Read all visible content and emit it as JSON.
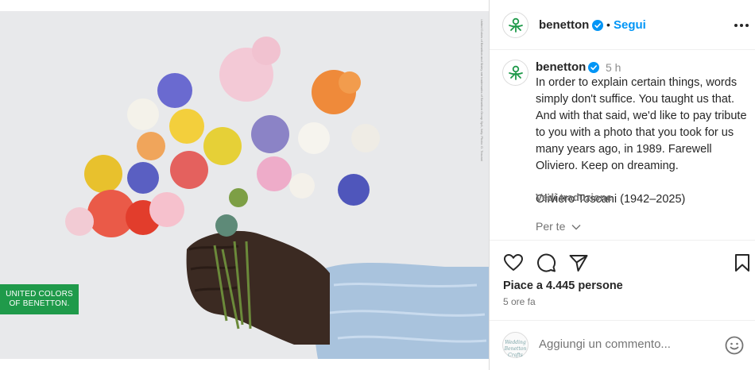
{
  "media": {
    "logo_line1": "UNITED COLORS",
    "logo_line2": "OF BENETTON.",
    "credit": "United Colors of Benetton and Sisley are trademarks of Benetton Group SpA, Italy. Photo: O. Toscani"
  },
  "header": {
    "username": "benetton",
    "dot": "•",
    "follow_label": "Segui"
  },
  "caption": {
    "username": "benetton",
    "time": "5 h",
    "text": "In order to explain certain things, words simply don't suffice. You taught us that. And with that said, we'd like to pay tribute to you with a photo that you took for us many years ago, in 1989. Farewell Oliviero. Keep on dreaming.",
    "signature": "Oliviero Toscani (1942–2025)",
    "translate_label": "Vedi traduzione",
    "for_you_label": "Per te"
  },
  "engagement": {
    "likes": "Piace a 4.445 persone",
    "ago": "5 ore fa"
  },
  "comment": {
    "avatar_text": "Wedding Benetton Crafts",
    "placeholder": "Aggiungi un commento..."
  },
  "colors": {
    "brand_green": "#1f9a4a",
    "link_blue": "#0095f6"
  }
}
